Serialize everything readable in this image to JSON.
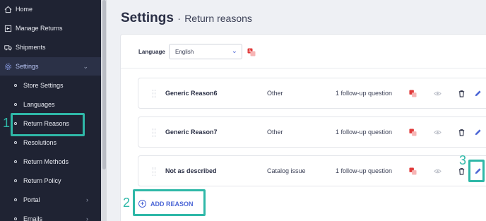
{
  "sidebar": {
    "items": [
      {
        "label": "Home",
        "icon": "home-icon"
      },
      {
        "label": "Manage Returns",
        "icon": "returns-icon"
      },
      {
        "label": "Shipments",
        "icon": "truck-icon"
      },
      {
        "label": "Settings",
        "icon": "gear-icon",
        "expanded": true
      }
    ],
    "subitems": [
      {
        "label": "Store Settings"
      },
      {
        "label": "Languages"
      },
      {
        "label": "Return Reasons"
      },
      {
        "label": "Resolutions"
      },
      {
        "label": "Return Methods"
      },
      {
        "label": "Return Policy"
      },
      {
        "label": "Portal"
      },
      {
        "label": "Emails"
      }
    ]
  },
  "header": {
    "title": "Settings",
    "separator": "·",
    "subtitle": "Return reasons"
  },
  "language": {
    "label": "Language",
    "value": "English"
  },
  "reasons": [
    {
      "name": "Generic Reason6",
      "type": "Other",
      "followup": "1 follow-up question"
    },
    {
      "name": "Generic Reason7",
      "type": "Other",
      "followup": "1 follow-up question"
    },
    {
      "name": "Not as described",
      "type": "Catalog issue",
      "followup": "1 follow-up question"
    }
  ],
  "add_reason": {
    "label": "ADD REASON"
  },
  "annotations": {
    "step1": "1",
    "step2": "2",
    "step3": "3"
  },
  "colors": {
    "sidebar_bg": "#1f2333",
    "accent": "#4d67d6",
    "highlight": "#2fb8a8",
    "translate_red": "#e03a3a"
  }
}
